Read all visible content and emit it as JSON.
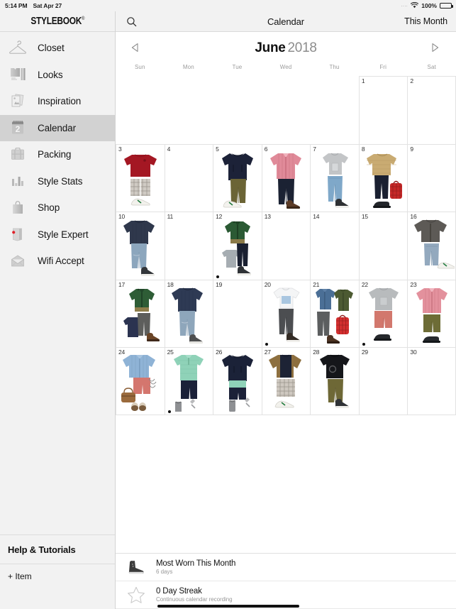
{
  "status_bar": {
    "time": "5:14 PM",
    "date": "Sat Apr 27",
    "signal_dots": "....",
    "wifi_icon": "wifi-icon",
    "battery_percent": "100%",
    "battery_icon": "battery-full-icon"
  },
  "sidebar": {
    "logo": "STYLEBOOK",
    "logo_mark": "®",
    "items": [
      {
        "label": "Closet",
        "icon": "hanger-icon",
        "active": false
      },
      {
        "label": "Looks",
        "icon": "outfit-icon",
        "active": false
      },
      {
        "label": "Inspiration",
        "icon": "photos-icon",
        "active": false
      },
      {
        "label": "Calendar",
        "icon": "calendar-icon",
        "active": true
      },
      {
        "label": "Packing",
        "icon": "suitcase-icon",
        "active": false
      },
      {
        "label": "Style Stats",
        "icon": "bar-chart-icon",
        "active": false
      },
      {
        "label": "Shop",
        "icon": "shopping-bag-icon",
        "active": false
      },
      {
        "label": "Style Expert",
        "icon": "book-badge-icon",
        "active": false
      },
      {
        "label": "Wifi Accept",
        "icon": "envelope-icon",
        "active": false
      }
    ],
    "calendar_icon_number": "2",
    "help_label": "Help & Tutorials",
    "add_item_label": "+ Item"
  },
  "topbar": {
    "search_icon": "search-icon",
    "title": "Calendar",
    "this_month_label": "This Month"
  },
  "month_header": {
    "prev_icon": "chevron-left-icon",
    "next_icon": "chevron-right-icon",
    "month": "June",
    "year": "2018"
  },
  "weekdays": [
    "Sun",
    "Mon",
    "Tue",
    "Wed",
    "Thu",
    "Fri",
    "Sat"
  ],
  "calendar": {
    "rows": [
      [
        {
          "day": "",
          "present": false,
          "outfit": null,
          "dot": false
        },
        {
          "day": "",
          "present": false,
          "outfit": null,
          "dot": false
        },
        {
          "day": "",
          "present": false,
          "outfit": null,
          "dot": false
        },
        {
          "day": "",
          "present": false,
          "outfit": null,
          "dot": false
        },
        {
          "day": "",
          "present": false,
          "outfit": null,
          "dot": false
        },
        {
          "day": "1",
          "present": true,
          "outfit": null,
          "dot": false
        },
        {
          "day": "2",
          "present": true,
          "outfit": null,
          "dot": false
        }
      ],
      [
        {
          "day": "3",
          "present": true,
          "outfit": "red-sweater-plaid-shorts-sneakers",
          "dot": false
        },
        {
          "day": "4",
          "present": true,
          "outfit": null,
          "dot": false
        },
        {
          "day": "5",
          "present": true,
          "outfit": "navy-hoodie-olive-pants-sneakers",
          "dot": false
        },
        {
          "day": "6",
          "present": true,
          "outfit": "pink-shirt-navy-jeans-brown-boots",
          "dot": false
        },
        {
          "day": "7",
          "present": true,
          "outfit": "grey-tee-blue-jeans-sneakers",
          "dot": false
        },
        {
          "day": "8",
          "present": true,
          "outfit": "tan-sweater-navy-pants-red-bag",
          "dot": false
        },
        {
          "day": "9",
          "present": true,
          "outfit": null,
          "dot": false
        }
      ],
      [
        {
          "day": "10",
          "present": true,
          "outfit": "navy-sweater-jeans-sneakers",
          "dot": false
        },
        {
          "day": "11",
          "present": true,
          "outfit": null,
          "dot": false
        },
        {
          "day": "12",
          "present": true,
          "outfit": "green-jacket-grey-tee-navy-pants",
          "dot": true
        },
        {
          "day": "13",
          "present": true,
          "outfit": null,
          "dot": false
        },
        {
          "day": "14",
          "present": true,
          "outfit": null,
          "dot": false
        },
        {
          "day": "15",
          "present": true,
          "outfit": null,
          "dot": false
        },
        {
          "day": "16",
          "present": true,
          "outfit": "grey-jacket-jeans-sneakers",
          "dot": false
        }
      ],
      [
        {
          "day": "17",
          "present": true,
          "outfit": "green-jacket-navy-sweater-boots",
          "dot": false
        },
        {
          "day": "18",
          "present": true,
          "outfit": "navy-sweater-jeans-grey-sneakers",
          "dot": false
        },
        {
          "day": "19",
          "present": true,
          "outfit": null,
          "dot": false
        },
        {
          "day": "20",
          "present": true,
          "outfit": "white-tee-grey-pants-boots",
          "dot": true
        },
        {
          "day": "21",
          "present": true,
          "outfit": "denim-shirt-olive-jacket-red-bag",
          "dot": false
        },
        {
          "day": "22",
          "present": true,
          "outfit": "grey-tee-red-shorts-black-shoes",
          "dot": true
        },
        {
          "day": "23",
          "present": true,
          "outfit": "pink-shirt-olive-shorts-shoes",
          "dot": false
        }
      ],
      [
        {
          "day": "24",
          "present": true,
          "outfit": "blue-shirt-red-shorts-tan-bag",
          "dot": false
        },
        {
          "day": "25",
          "present": true,
          "outfit": "mint-polo-navy-shorts-sandals",
          "dot": true
        },
        {
          "day": "26",
          "present": true,
          "outfit": "navy-hoodie-mint-navy-swim",
          "dot": false
        },
        {
          "day": "27",
          "present": true,
          "outfit": "tan-navy-raglan-plaid-shorts",
          "dot": false
        },
        {
          "day": "28",
          "present": true,
          "outfit": "black-tee-olive-pants-sneakers",
          "dot": false
        },
        {
          "day": "29",
          "present": true,
          "outfit": null,
          "dot": false
        },
        {
          "day": "30",
          "present": true,
          "outfit": null,
          "dot": false
        }
      ]
    ]
  },
  "stats": [
    {
      "icon": "sneaker-icon",
      "title": "Most Worn This Month",
      "subtitle": "6 days"
    },
    {
      "icon": "star-outline-icon",
      "title": "0 Day Streak",
      "subtitle": "Continuous calendar recording"
    }
  ],
  "colors": {
    "sidebar_bg": "#f2f2f2",
    "sidebar_active": "#d2d2d2",
    "content_bg": "#ffffff",
    "grid_line": "#e2e2e2",
    "muted_text": "#9b9b9b",
    "primary_text": "#111111",
    "accent_red": "#e0222a"
  }
}
